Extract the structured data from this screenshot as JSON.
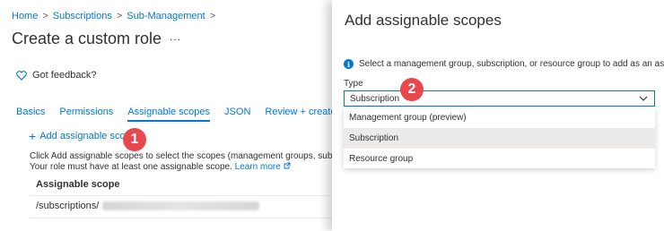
{
  "breadcrumb": {
    "items": [
      "Home",
      "Subscriptions",
      "Sub-Management"
    ],
    "separator": ">"
  },
  "page": {
    "title": "Create a custom role",
    "more": "..."
  },
  "feedback": {
    "label": "Got feedback?"
  },
  "tabs": [
    {
      "label": "Basics",
      "active": false
    },
    {
      "label": "Permissions",
      "active": false
    },
    {
      "label": "Assignable scopes",
      "active": true
    },
    {
      "label": "JSON",
      "active": false
    },
    {
      "label": "Review + create",
      "active": false
    }
  ],
  "scopes": {
    "add_label": "Add assignable scopes",
    "description_line1": "Click Add assignable scopes to select the scopes (management groups, subscriptio",
    "description_line2": "Your role must have at least one assignable scope.",
    "learn_more": "Learn more",
    "column_header": "Assignable scope",
    "row_prefix": "/subscriptions/"
  },
  "callouts": {
    "one": "1",
    "two": "2"
  },
  "blade": {
    "title": "Add assignable scopes",
    "info_text": "Select a management group, subscription, or resource group to add as an assignabl",
    "type_label": "Type",
    "selected_value": "Subscription",
    "options": [
      "Management group (preview)",
      "Subscription",
      "Resource group"
    ],
    "highlighted_option": "Subscription"
  },
  "colors": {
    "accent": "#0078d4",
    "callout": "#e8474e",
    "highlight": "#edebe9"
  }
}
